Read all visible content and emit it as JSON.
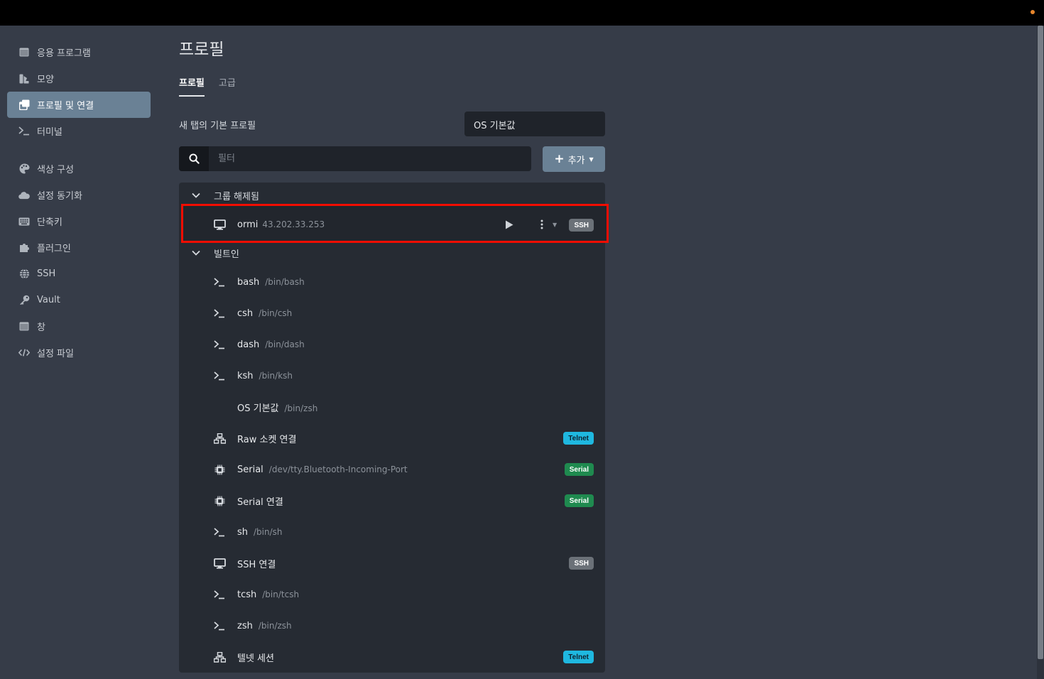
{
  "sidebar": {
    "items": [
      {
        "label": "응용 프로그램",
        "icon": "window-icon"
      },
      {
        "label": "모양",
        "icon": "paint-icon"
      },
      {
        "label": "프로필 및 연결",
        "icon": "profiles-icon"
      },
      {
        "label": "터미널",
        "icon": "terminal-icon"
      },
      {
        "label": "색상 구성",
        "icon": "palette-icon"
      },
      {
        "label": "설정 동기화",
        "icon": "cloud-icon"
      },
      {
        "label": "단축키",
        "icon": "keyboard-icon"
      },
      {
        "label": "플러그인",
        "icon": "puzzle-icon"
      },
      {
        "label": "SSH",
        "icon": "globe-icon"
      },
      {
        "label": "Vault",
        "icon": "key-icon"
      },
      {
        "label": "창",
        "icon": "window-icon"
      },
      {
        "label": "설정 파일",
        "icon": "code-icon"
      }
    ],
    "active_index": 2
  },
  "main": {
    "title": "프로필",
    "tabs": [
      {
        "label": "프로필"
      },
      {
        "label": "고급"
      }
    ],
    "default_profile_label": "새 탭의 기본 프로필",
    "default_profile_value": "OS 기본값",
    "filter_placeholder": "필터",
    "add_button_label": "추가"
  },
  "groups": {
    "ungrouped_label": "그룹 해제됨",
    "builtin_label": "빌트인"
  },
  "ungrouped_profiles": [
    {
      "name": "ormi",
      "path": "43.202.33.253",
      "icon": "monitor-icon",
      "badge": "SSH"
    }
  ],
  "builtin_profiles": [
    {
      "name": "bash",
      "path": "/bin/bash",
      "icon": "terminal-icon",
      "badge": ""
    },
    {
      "name": "csh",
      "path": "/bin/csh",
      "icon": "terminal-icon",
      "badge": ""
    },
    {
      "name": "dash",
      "path": "/bin/dash",
      "icon": "terminal-icon",
      "badge": ""
    },
    {
      "name": "ksh",
      "path": "/bin/ksh",
      "icon": "terminal-icon",
      "badge": ""
    },
    {
      "name": "OS 기본값",
      "path": "/bin/zsh",
      "icon": "",
      "badge": ""
    },
    {
      "name": "Raw 소켓 연결",
      "path": "",
      "icon": "network-icon",
      "badge": "Telnet"
    },
    {
      "name": "Serial",
      "path": "/dev/tty.Bluetooth-Incoming-Port",
      "icon": "chip-icon",
      "badge": "Serial"
    },
    {
      "name": "Serial 연결",
      "path": "",
      "icon": "chip-icon",
      "badge": "Serial"
    },
    {
      "name": "sh",
      "path": "/bin/sh",
      "icon": "terminal-icon",
      "badge": ""
    },
    {
      "name": "SSH 연결",
      "path": "",
      "icon": "monitor-icon",
      "badge": "SSH"
    },
    {
      "name": "tcsh",
      "path": "/bin/tcsh",
      "icon": "terminal-icon",
      "badge": ""
    },
    {
      "name": "zsh",
      "path": "/bin/zsh",
      "icon": "terminal-icon",
      "badge": ""
    },
    {
      "name": "텔넷 세션",
      "path": "",
      "icon": "network-icon",
      "badge": "Telnet"
    }
  ],
  "colors": {
    "background": "#363c48",
    "accent": "#6a8195",
    "highlight_border": "#f20d00",
    "telnet_badge": "#1fb8e0",
    "serial_badge": "#1f8a4f",
    "ssh_badge": "#6b7178"
  }
}
